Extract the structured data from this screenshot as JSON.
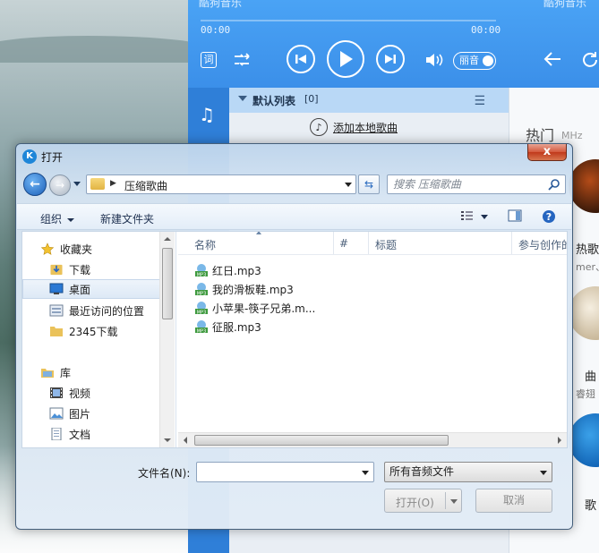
{
  "player": {
    "title": "酷狗音乐",
    "top_right": "酷狗音乐",
    "time_elapsed": "00:00",
    "time_total": "00:00",
    "lyrics_label": "词",
    "quality_label": "丽音",
    "playlist_title": "默认列表",
    "playlist_count": "[0]",
    "add_local_label": "添加本地歌曲",
    "hot_label": "热门",
    "mhz_label": "MHz",
    "right_text_1": "热歌",
    "right_text_2": "mer、",
    "right_text_3": "曲",
    "right_text_4": "睿翅",
    "right_text_5": "歌"
  },
  "dialog": {
    "title": "打开",
    "close_label": "x",
    "address": {
      "path": "压缩歌曲"
    },
    "search": {
      "placeholder": "搜索 压缩歌曲"
    },
    "toolbar": {
      "organize": "组织",
      "new_folder": "新建文件夹"
    },
    "nav": {
      "favorites": "收藏夹",
      "downloads": "下载",
      "desktop": "桌面",
      "recent": "最近访问的位置",
      "downloads_2345": "2345下载",
      "libraries": "库",
      "videos": "视频",
      "pictures": "图片",
      "documents": "文档"
    },
    "columns": {
      "name": "名称",
      "number": "#",
      "title": "标题",
      "artists": "参与创作的艺"
    },
    "files": [
      {
        "name": "红日.mp3"
      },
      {
        "name": "我的滑板鞋.mp3"
      },
      {
        "name": "小苹果-筷子兄弟.m..."
      },
      {
        "name": "征服.mp3"
      }
    ],
    "file_name_label": "文件名(N):",
    "file_name_value": "",
    "file_type": "所有音频文件",
    "open_button": "打开(O)",
    "cancel_button": "取消"
  }
}
